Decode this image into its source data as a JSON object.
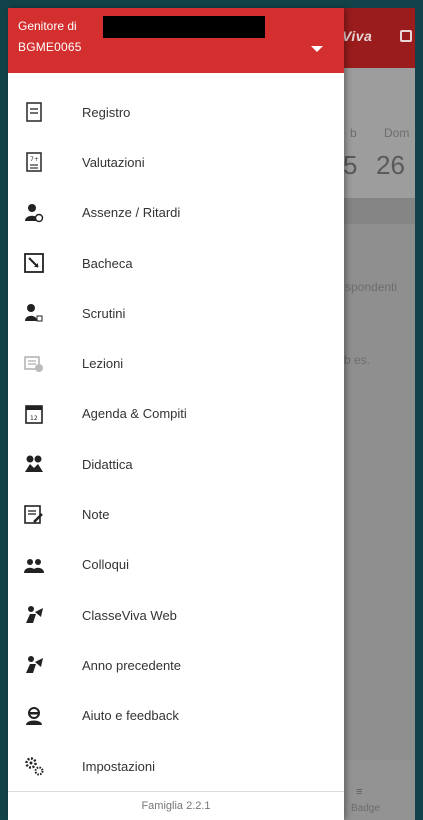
{
  "header": {
    "role_label": "Genitore di",
    "username": "BGME0065"
  },
  "menu": [
    {
      "label": "Registro",
      "icon": "register-icon"
    },
    {
      "label": "Valutazioni",
      "icon": "grades-icon"
    },
    {
      "label": "Assenze / Ritardi",
      "icon": "absences-icon"
    },
    {
      "label": "Bacheca",
      "icon": "noticeboard-icon"
    },
    {
      "label": "Scrutini",
      "icon": "report-card-icon"
    },
    {
      "label": "Lezioni",
      "icon": "lessons-icon"
    },
    {
      "label": "Agenda & Compiti",
      "icon": "calendar-icon"
    },
    {
      "label": "Didattica",
      "icon": "teaching-materials-icon"
    },
    {
      "label": "Note",
      "icon": "notes-icon"
    },
    {
      "label": "Colloqui",
      "icon": "meetings-icon"
    },
    {
      "label": "ClasseViva Web",
      "icon": "web-icon"
    },
    {
      "label": "Anno precedente",
      "icon": "previous-year-icon"
    },
    {
      "label": "Aiuto e feedback",
      "icon": "help-icon"
    },
    {
      "label": "Impostazioni",
      "icon": "settings-icon"
    }
  ],
  "footer": {
    "version": "Famiglia 2.2.1"
  },
  "background": {
    "brand": "Viva",
    "day_labels": [
      "b",
      "Dom"
    ],
    "day_numbers": [
      "5",
      "26"
    ],
    "snippet1": "spondenti",
    "snippet2": "b es.",
    "bottom_icon": "≡",
    "bottom_label": "Badge"
  },
  "colors": {
    "header": "#d32f2f",
    "overlay": "#8f8f8f",
    "frame": "#13434a"
  }
}
